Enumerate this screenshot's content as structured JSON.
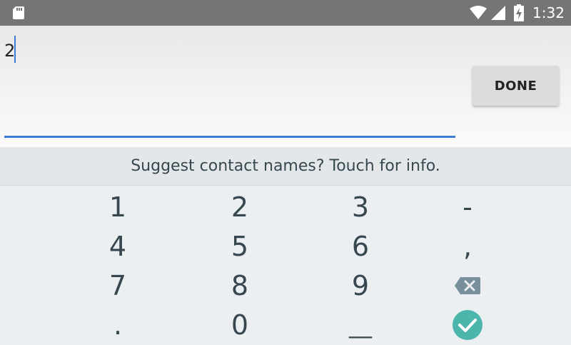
{
  "status_bar": {
    "time": "1:32",
    "icons": [
      "sd-card-icon",
      "wifi-icon",
      "cell-signal-icon",
      "battery-charging-icon"
    ]
  },
  "edit": {
    "value": "2",
    "done_label": "DONE",
    "accent_color": "#3f7ad6"
  },
  "suggestion": {
    "text": "Suggest contact names? Touch for info."
  },
  "keypad": {
    "row1": [
      "1",
      "2",
      "3",
      "-"
    ],
    "row2": [
      "4",
      "5",
      "6",
      ","
    ],
    "row3": [
      "7",
      "8",
      "9"
    ],
    "row4": [
      ".",
      "0",
      "__"
    ],
    "backspace_icon": "backspace-icon",
    "enter_icon": "check-circle-icon",
    "enter_color": "#4db6ac"
  }
}
